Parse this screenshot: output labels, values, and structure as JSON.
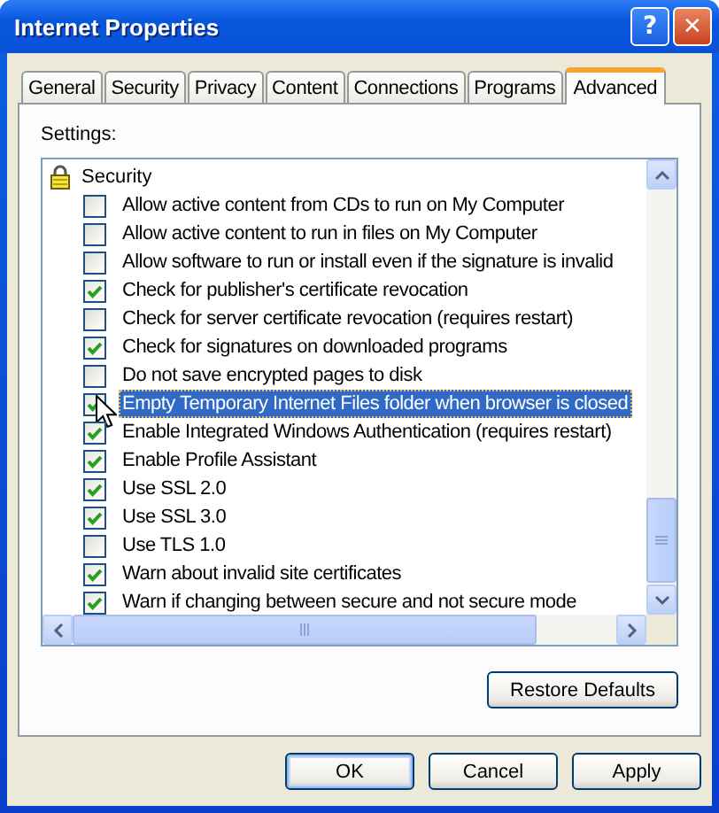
{
  "window": {
    "title": "Internet Properties",
    "title_buttons": [
      {
        "kind": "help",
        "label": "?"
      },
      {
        "kind": "close",
        "label": "✕"
      }
    ]
  },
  "tabs": [
    {
      "label": "General",
      "selected": false
    },
    {
      "label": "Security",
      "selected": false
    },
    {
      "label": "Privacy",
      "selected": false
    },
    {
      "label": "Content",
      "selected": false
    },
    {
      "label": "Connections",
      "selected": false
    },
    {
      "label": "Programs",
      "selected": false
    },
    {
      "label": "Advanced",
      "selected": true
    }
  ],
  "settings_label": "Settings:",
  "settings_tree": [
    {
      "label": "Security",
      "kind": "category",
      "children": [
        {
          "label": "Allow active content from CDs to run on My Computer",
          "checked": false,
          "selected": false
        },
        {
          "label": "Allow active content to run in files on My Computer",
          "checked": false,
          "selected": false
        },
        {
          "label": "Allow software to run or install even if the signature is invalid",
          "checked": false,
          "selected": false
        },
        {
          "label": "Check for publisher's certificate revocation",
          "checked": true,
          "selected": false
        },
        {
          "label": "Check for server certificate revocation (requires restart)",
          "checked": false,
          "selected": false
        },
        {
          "label": "Check for signatures on downloaded programs",
          "checked": true,
          "selected": false
        },
        {
          "label": "Do not save encrypted pages to disk",
          "checked": false,
          "selected": false
        },
        {
          "label": "Empty Temporary Internet Files folder when browser is closed",
          "checked": true,
          "selected": true
        },
        {
          "label": "Enable Integrated Windows Authentication (requires restart)",
          "checked": true,
          "selected": false
        },
        {
          "label": "Enable Profile Assistant",
          "checked": true,
          "selected": false
        },
        {
          "label": "Use SSL 2.0",
          "checked": true,
          "selected": false
        },
        {
          "label": "Use SSL 3.0",
          "checked": true,
          "selected": false
        },
        {
          "label": "Use TLS 1.0",
          "checked": false,
          "selected": false
        },
        {
          "label": "Warn about invalid site certificates",
          "checked": true,
          "selected": false
        },
        {
          "label": "Warn if changing between secure and not secure mode",
          "checked": true,
          "selected": false
        }
      ]
    }
  ],
  "restore_button": "Restore Defaults",
  "buttons": [
    {
      "label": "OK",
      "kind": "default"
    },
    {
      "label": "Cancel",
      "kind": "normal"
    },
    {
      "label": "Apply",
      "kind": "normal"
    }
  ]
}
